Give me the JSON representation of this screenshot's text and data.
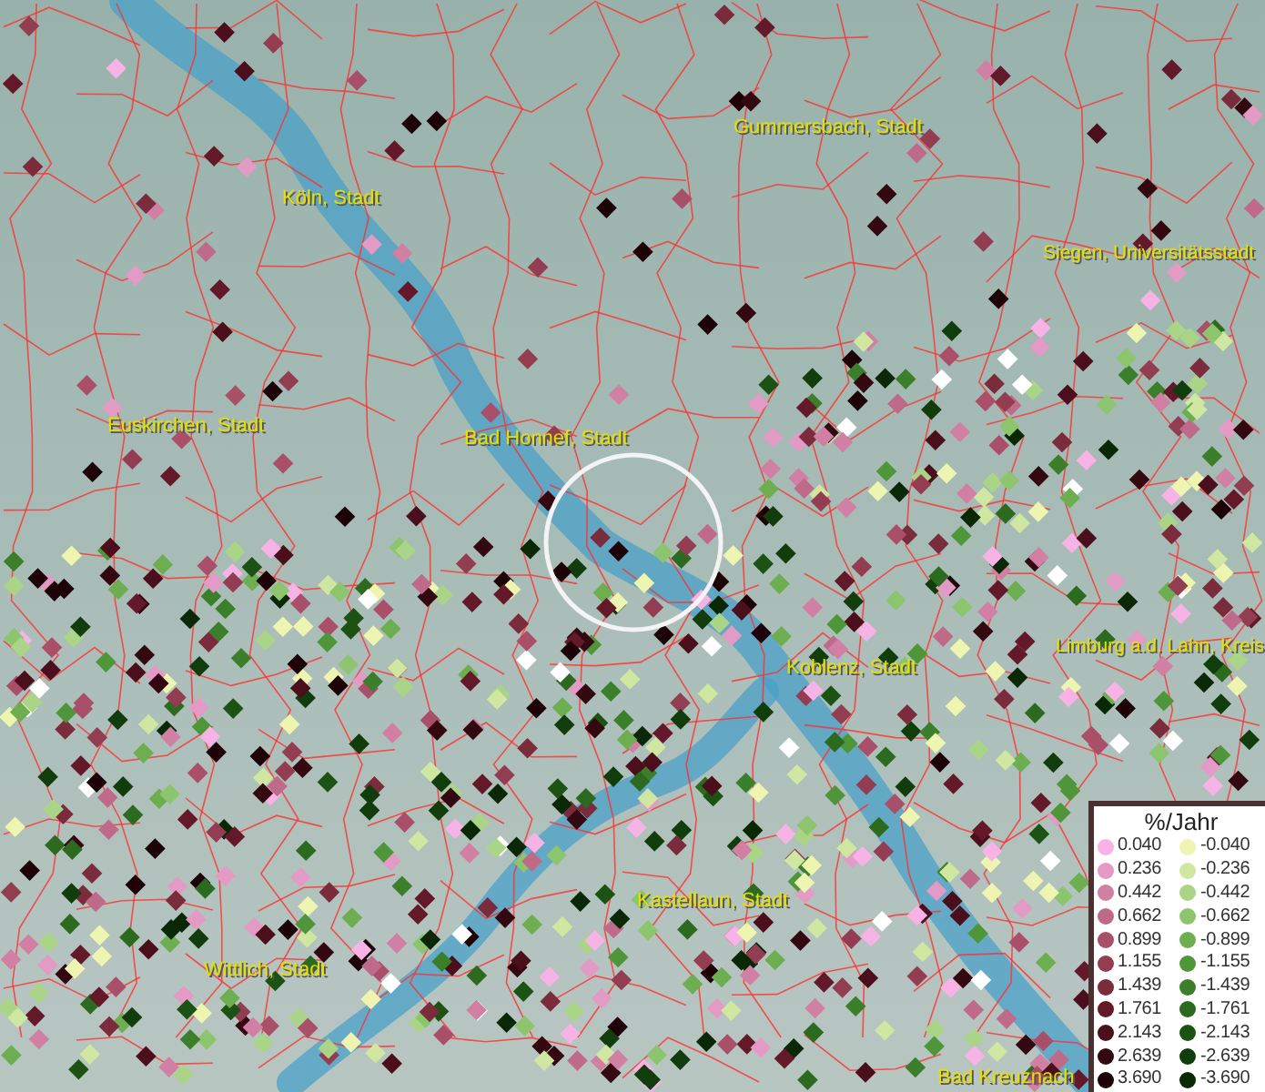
{
  "map": {
    "labels": [
      {
        "text": "Gummersbach, Stadt"
      },
      {
        "text": "Köln, Stadt"
      },
      {
        "text": "Siegen, Universitätsstadt"
      },
      {
        "text": "Euskirchen, Stadt"
      },
      {
        "text": "Bad Honnef, Stadt"
      },
      {
        "text": "Limburg a.d. Lahn, Kreis"
      },
      {
        "text": "Koblenz, Stadt"
      },
      {
        "text": "Kastellaun, Stadt"
      },
      {
        "text": "Wittlich, Stadt"
      },
      {
        "text": "Bad Kreuznach"
      }
    ]
  },
  "legend": {
    "title": "%/Jahr",
    "positive": [
      {
        "value": "0.040",
        "color": "#f7b3e6"
      },
      {
        "value": "0.236",
        "color": "#e39ac4"
      },
      {
        "value": "0.442",
        "color": "#d17fa3"
      },
      {
        "value": "0.662",
        "color": "#c06a8a"
      },
      {
        "value": "0.899",
        "color": "#a94f6a"
      },
      {
        "value": "1.155",
        "color": "#923d52"
      },
      {
        "value": "1.439",
        "color": "#7a2b3c"
      },
      {
        "value": "1.761",
        "color": "#63192a"
      },
      {
        "value": "2.143",
        "color": "#4a0e1c"
      },
      {
        "value": "2.639",
        "color": "#330810"
      },
      {
        "value": "3.690",
        "color": "#1d0308"
      }
    ],
    "negative": [
      {
        "value": "-0.040",
        "color": "#eef5b0"
      },
      {
        "value": "-0.236",
        "color": "#cfe7a0"
      },
      {
        "value": "-0.442",
        "color": "#aad587"
      },
      {
        "value": "-0.662",
        "color": "#8cc56e"
      },
      {
        "value": "-0.899",
        "color": "#6cae50"
      },
      {
        "value": "-1.155",
        "color": "#4f963a"
      },
      {
        "value": "-1.439",
        "color": "#3b7f2a"
      },
      {
        "value": "-1.761",
        "color": "#2b6a1f"
      },
      {
        "value": "-2.143",
        "color": "#1c5314"
      },
      {
        "value": "-2.639",
        "color": "#113d0d"
      },
      {
        "value": "-3.690",
        "color": "#0a2806"
      }
    ]
  }
}
